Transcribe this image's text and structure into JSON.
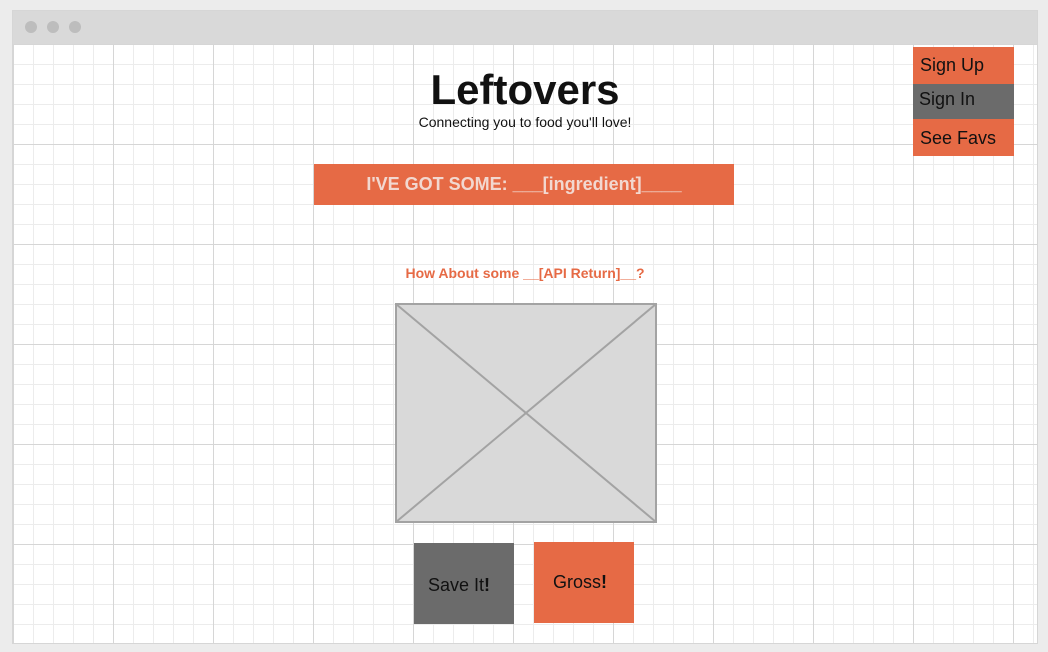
{
  "app": {
    "title": "Leftovers",
    "subtitle": "Connecting you to food you'll love!"
  },
  "nav": {
    "items": [
      {
        "label": "Sign Up"
      },
      {
        "label": "Sign In"
      },
      {
        "label": "See Favs"
      }
    ]
  },
  "search": {
    "value": "I'VE GOT SOME: ___[ingredient]____"
  },
  "result": {
    "question": "How About some __[API Return]__?",
    "image_icon": "image-placeholder-icon"
  },
  "actions": {
    "save_label": "Save It",
    "gross_label": "Gross",
    "exclaim": "!"
  },
  "colors": {
    "accent": "#e66a45",
    "dark": "#6b6b6b",
    "titlebar": "#d9d9d9"
  }
}
